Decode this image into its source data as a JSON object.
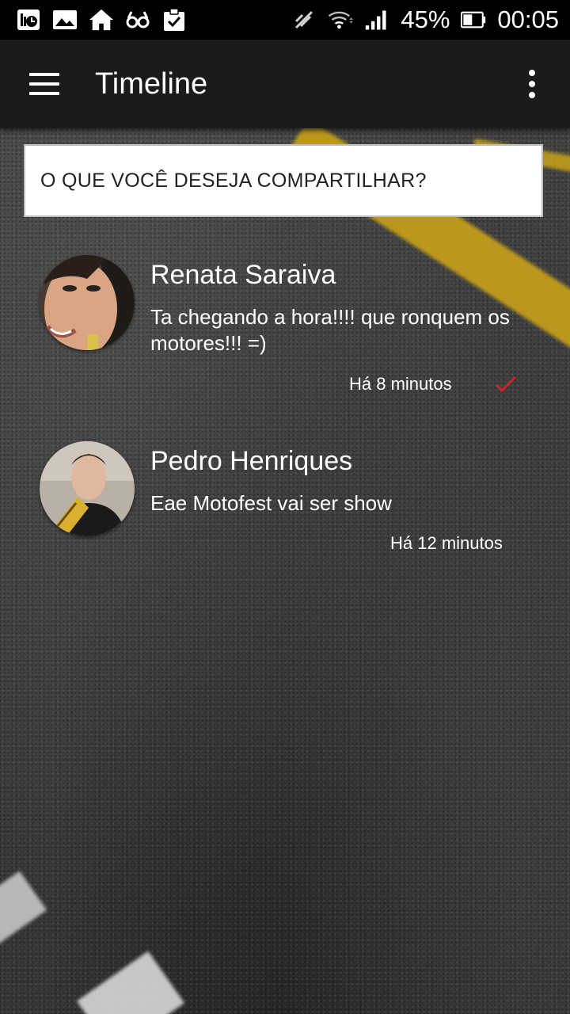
{
  "status_bar": {
    "battery": "45%",
    "time": "00:05",
    "icons": [
      "sim-toolkit-icon",
      "gallery-icon",
      "home-icon",
      "glasses-icon",
      "clipboard-check-icon",
      "mute-icon",
      "wifi-icon",
      "signal-icon",
      "battery-icon"
    ]
  },
  "app_bar": {
    "title": "Timeline",
    "menu_icon": "hamburger-icon",
    "overflow_icon": "more-vert-icon"
  },
  "share": {
    "prompt": "O QUE VOCÊ DESEJA COMPARTILHAR?"
  },
  "posts": [
    {
      "name": "Renata Saraiva",
      "text": "Ta chegando a hora!!!! que ronquem os motores!!! =)",
      "time": "Há 8 minutos",
      "checked": true,
      "check_color": "#c62828"
    },
    {
      "name": "Pedro Henriques",
      "text": "Eae Motofest vai ser show",
      "time": "Há 12 minutos",
      "checked": false
    }
  ],
  "colors": {
    "status_bar": "#000000",
    "app_bar": "#1b1b1b",
    "accent_yellow": "#c9a21a"
  }
}
